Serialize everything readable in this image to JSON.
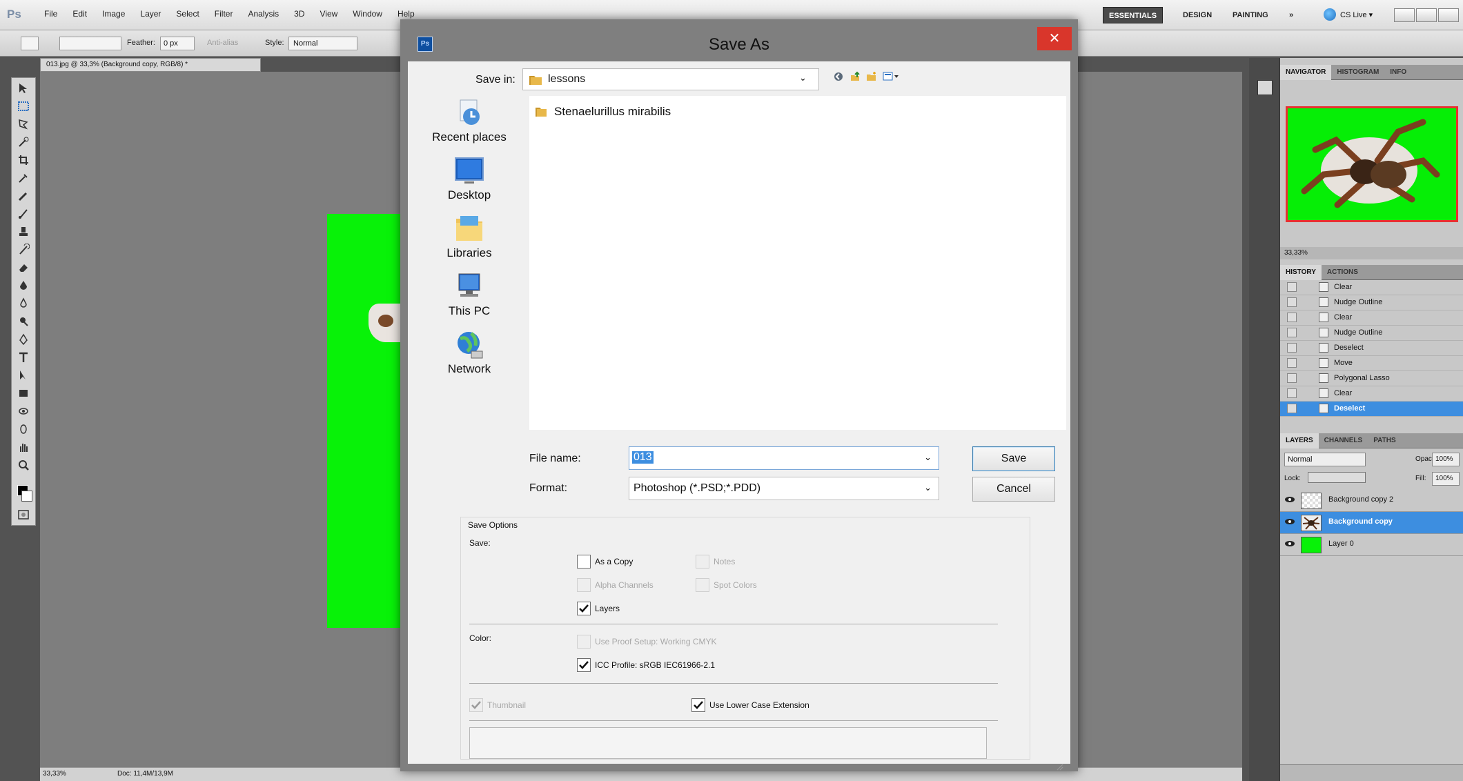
{
  "app": {
    "logo": "Ps",
    "menu": [
      "File",
      "Edit",
      "Image",
      "Layer",
      "Select",
      "Filter",
      "Analysis",
      "3D",
      "View",
      "Window",
      "Help"
    ],
    "workspaces": [
      "ESSENTIALS",
      "DESIGN",
      "PAINTING",
      "»"
    ],
    "cs_live": "CS Live ▾"
  },
  "options_bar": {
    "feather_label": "Feather:",
    "feather_value": "0 px",
    "antialias_label": "Anti-alias",
    "style_label": "Style:",
    "style_value": "Normal"
  },
  "document": {
    "tab_title": "013.jpg @ 33,3% (Background copy, RGB/8) *"
  },
  "status_bar": {
    "zoom": "33,33%",
    "doc_info": "Doc: 11,4M/13,9M"
  },
  "panels": {
    "navigator_tabs": [
      "NAVIGATOR",
      "HISTOGRAM",
      "INFO"
    ],
    "navigator_zoom": "33,33%",
    "history_tabs": [
      "HISTORY",
      "ACTIONS"
    ],
    "history_items": [
      {
        "label": "Clear"
      },
      {
        "label": "Nudge Outline"
      },
      {
        "label": "Clear"
      },
      {
        "label": "Nudge Outline"
      },
      {
        "label": "Deselect"
      },
      {
        "label": "Move"
      },
      {
        "label": "Polygonal Lasso"
      },
      {
        "label": "Clear"
      },
      {
        "label": "Deselect",
        "selected": true
      }
    ],
    "layers_tabs": [
      "LAYERS",
      "CHANNELS",
      "PATHS"
    ],
    "blend_mode": "Normal",
    "opacity_label": "Opacity:",
    "opacity_value": "100%",
    "lock_label": "Lock:",
    "fill_label": "Fill:",
    "fill_value": "100%",
    "layers": [
      {
        "name": "Background copy 2",
        "thumb": "transparent"
      },
      {
        "name": "Background copy",
        "thumb": "spider",
        "selected": true
      },
      {
        "name": "Layer 0",
        "thumb": "#08f208"
      }
    ]
  },
  "dialog": {
    "title": "Save As",
    "save_in_label": "Save in:",
    "save_in_value": "lessons",
    "places": [
      "Recent places",
      "Desktop",
      "Libraries",
      "This PC",
      "Network"
    ],
    "files": [
      "Stenaelurillus mirabilis"
    ],
    "file_name_label": "File name:",
    "file_name_value": "013",
    "format_label": "Format:",
    "format_value": "Photoshop (*.PSD;*.PDD)",
    "save_button": "Save",
    "cancel_button": "Cancel",
    "save_options": {
      "title": "Save Options",
      "save_label": "Save:",
      "as_a_copy": "As a Copy",
      "notes": "Notes",
      "alpha_channels": "Alpha Channels",
      "spot_colors": "Spot Colors",
      "layers": "Layers",
      "color_label": "Color:",
      "use_proof_setup": "Use Proof Setup:  Working CMYK",
      "icc_profile": "ICC Profile:  sRGB IEC61966-2.1",
      "thumbnail": "Thumbnail",
      "use_lower_case": "Use Lower Case Extension"
    }
  },
  "colors": {
    "accent_selection": "#3d8ee0",
    "canvas_green": "#08f208",
    "close_red": "#d9362b"
  }
}
